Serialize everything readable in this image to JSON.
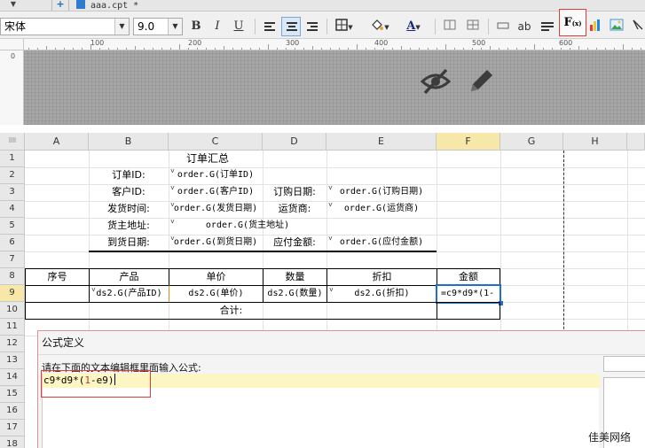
{
  "tabs": {
    "file_name": "aaa.cpt *"
  },
  "toolbar": {
    "font_family": "宋体",
    "font_size": "9.0",
    "bold": "B",
    "italic": "I",
    "underline": "U",
    "text_label": "ab",
    "fx_main": "F",
    "fx_sub": "(x)"
  },
  "ruler": {
    "marks": [
      "100",
      "200",
      "300",
      "400",
      "500",
      "600"
    ],
    "vertical_mark": "0"
  },
  "columns": [
    "A",
    "B",
    "C",
    "D",
    "E",
    "F",
    "G",
    "H"
  ],
  "rows": [
    "1",
    "2",
    "3",
    "4",
    "5",
    "6",
    "7",
    "8",
    "9",
    "10",
    "11",
    "12",
    "13",
    "14",
    "15",
    "16",
    "17",
    "18"
  ],
  "report": {
    "title": "订单汇总",
    "order_id_label": "订单ID:",
    "order_id_value": "order.G(订单ID)",
    "customer_id_label": "客户ID:",
    "customer_id_value": "order.G(客户ID)",
    "order_date_label": "订购日期:",
    "order_date_value": "order.G(订购日期)",
    "ship_time_label": "发货时间:",
    "ship_time_value": "order.G(发货日期)",
    "carrier_label": "运货商:",
    "carrier_value": "order.G(运货商)",
    "cargo_addr_label": "货主地址:",
    "cargo_addr_value": "order.G(货主地址)",
    "arrival_label": "到货日期:",
    "arrival_value": "order.G(到货日期)",
    "payable_label": "应付金额:",
    "payable_value": "order.G(应付金额)",
    "headers": {
      "seq": "序号",
      "product": "产品",
      "price": "单价",
      "qty": "数量",
      "discount": "折扣",
      "amount": "金额"
    },
    "detail": {
      "product": "ds2.G(产品ID)",
      "price": "ds2.G(单价)",
      "qty": "ds2.G(数量)",
      "discount": "ds2.G(折扣)",
      "amount": "=c9*d9*(1-"
    },
    "total_label": "合计:"
  },
  "dialog": {
    "title": "公式定义",
    "hint": "请在下面的文本编辑框里面输入公式:",
    "formula_a": "c9*d9*(",
    "formula_num": "1",
    "formula_b": "-e9)"
  },
  "watermark": "佳美网络"
}
